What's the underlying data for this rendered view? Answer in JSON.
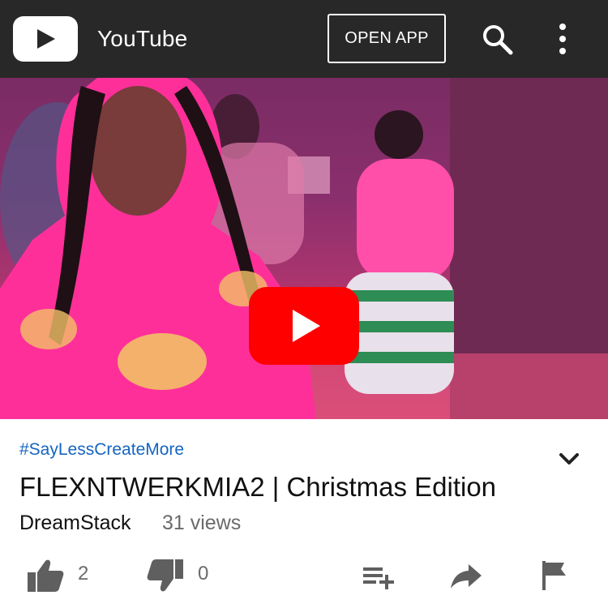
{
  "app": {
    "title": "YouTube",
    "open_app_label": "OPEN APP",
    "icons": [
      "youtube-logo-icon",
      "search-icon",
      "more-vert-icon"
    ]
  },
  "player": {
    "play_icon": "play-icon",
    "accent_color": "#ff0000"
  },
  "video": {
    "hashtag": "#SayLessCreateMore",
    "title": "FLEXNTWERKMIA2 | Christmas Edition",
    "channel": "DreamStack",
    "views": "31 views",
    "hashtag_color": "#1565c0"
  },
  "actions": {
    "likes": "2",
    "dislikes": "0",
    "icons": [
      "thumb-up-icon",
      "thumb-down-icon",
      "add-to-playlist-icon",
      "share-icon",
      "flag-icon"
    ]
  }
}
